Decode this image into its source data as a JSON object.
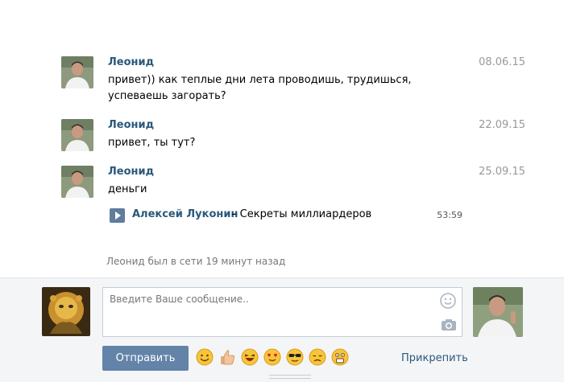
{
  "messages": [
    {
      "author": "Леонид",
      "date": "08.06.15",
      "text": "привет)) как теплые дни лета проводишь, трудишься, успеваешь загорать?"
    },
    {
      "author": "Леонид",
      "date": "22.09.15",
      "text": "привет, ты тут?"
    },
    {
      "author": "Леонид",
      "date": "25.09.15",
      "text": "деньги",
      "audio": {
        "artist": "Алексей Луконин",
        "separator": " – ",
        "title": "Секреты миллиардеров",
        "duration": "53:59"
      }
    }
  ],
  "status": "Леонид был в сети 19 минут назад",
  "composer": {
    "placeholder": "Введите Ваше сообщение..",
    "send_label": "Отправить",
    "attach_label": "Прикрепить",
    "emoji": [
      "smile",
      "thumbs-up",
      "laughing",
      "heart-eyes",
      "sunglasses",
      "disappointed",
      "scared"
    ]
  },
  "colors": {
    "link": "#2b587a",
    "button": "#6383a8",
    "date": "#999999",
    "panel": "#f4f5f7"
  },
  "icons": {
    "smile": "smile-icon",
    "camera": "camera-icon",
    "play": "play-icon"
  }
}
